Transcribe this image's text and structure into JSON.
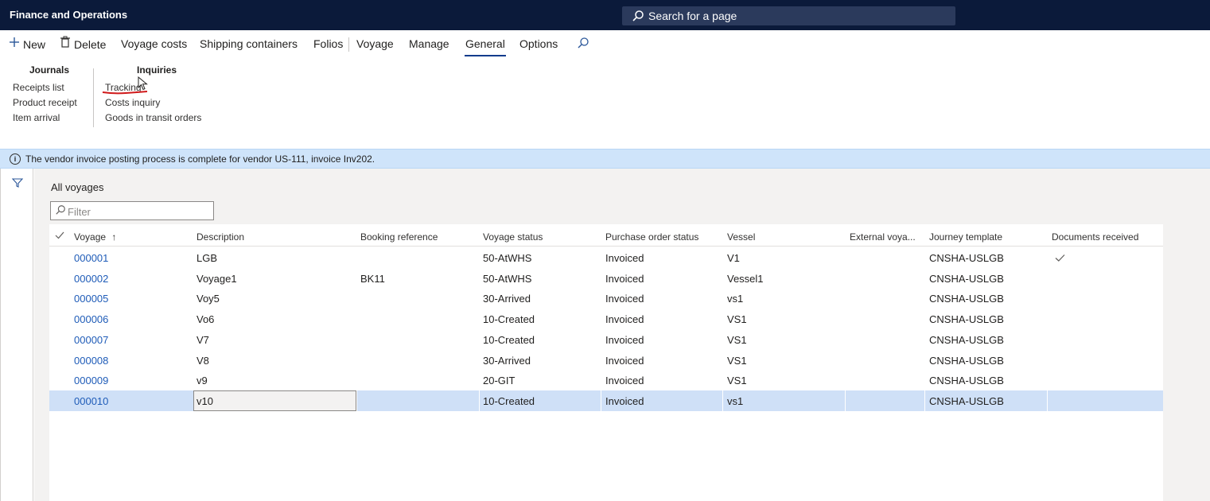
{
  "topbar": {
    "app_title": "Finance and Operations",
    "search_placeholder": "Search for a page"
  },
  "actionpane": {
    "tabs": [
      {
        "label": "New"
      },
      {
        "label": "Delete"
      },
      {
        "label": "Voyage costs"
      },
      {
        "label": "Shipping containers"
      },
      {
        "label": "Folios"
      },
      {
        "label": "Voyage"
      },
      {
        "label": "Manage"
      },
      {
        "label": "General",
        "active": true
      },
      {
        "label": "Options"
      }
    ],
    "groups": [
      {
        "title": "Journals",
        "items": [
          "Receipts list",
          "Product receipt",
          "Item arrival"
        ]
      },
      {
        "title": "Inquiries",
        "items": [
          "Tracking",
          "Costs inquiry",
          "Goods in transit orders"
        ]
      }
    ]
  },
  "message_bar": {
    "text": "The vendor invoice posting process is complete for vendor US-111, invoice Inv202."
  },
  "view": {
    "title": "All voyages",
    "filter_placeholder": "Filter"
  },
  "grid": {
    "columns": [
      "Voyage",
      "Description",
      "Booking reference",
      "Voyage status",
      "Purchase order status",
      "Vessel",
      "External voya...",
      "Journey template",
      "Documents received"
    ],
    "sort_indicator": "↑",
    "rows": [
      {
        "voyage": "000001",
        "description": "LGB",
        "booking": "",
        "status": "50-AtWHS",
        "po_status": "Invoiced",
        "vessel": "V1",
        "external": "",
        "template": "CNSHA-USLGB",
        "docs_received": true
      },
      {
        "voyage": "000002",
        "description": "Voyage1",
        "booking": "BK11",
        "status": "50-AtWHS",
        "po_status": "Invoiced",
        "vessel": "Vessel1",
        "external": "",
        "template": "CNSHA-USLGB",
        "docs_received": false
      },
      {
        "voyage": "000005",
        "description": "Voy5",
        "booking": "",
        "status": "30-Arrived",
        "po_status": "Invoiced",
        "vessel": "vs1",
        "external": "",
        "template": "CNSHA-USLGB",
        "docs_received": false
      },
      {
        "voyage": "000006",
        "description": "Vo6",
        "booking": "",
        "status": "10-Created",
        "po_status": "Invoiced",
        "vessel": "VS1",
        "external": "",
        "template": "CNSHA-USLGB",
        "docs_received": false
      },
      {
        "voyage": "000007",
        "description": "V7",
        "booking": "",
        "status": "10-Created",
        "po_status": "Invoiced",
        "vessel": "VS1",
        "external": "",
        "template": "CNSHA-USLGB",
        "docs_received": false
      },
      {
        "voyage": "000008",
        "description": "V8",
        "booking": "",
        "status": "30-Arrived",
        "po_status": "Invoiced",
        "vessel": "VS1",
        "external": "",
        "template": "CNSHA-USLGB",
        "docs_received": false
      },
      {
        "voyage": "000009",
        "description": "v9",
        "booking": "",
        "status": "20-GIT",
        "po_status": "Invoiced",
        "vessel": "VS1",
        "external": "",
        "template": "CNSHA-USLGB",
        "docs_received": false
      },
      {
        "voyage": "000010",
        "description": "v10",
        "booking": "",
        "status": "10-Created",
        "po_status": "Invoiced",
        "vessel": "vs1",
        "external": "",
        "template": "CNSHA-USLGB",
        "docs_received": false,
        "selected": true
      }
    ]
  }
}
